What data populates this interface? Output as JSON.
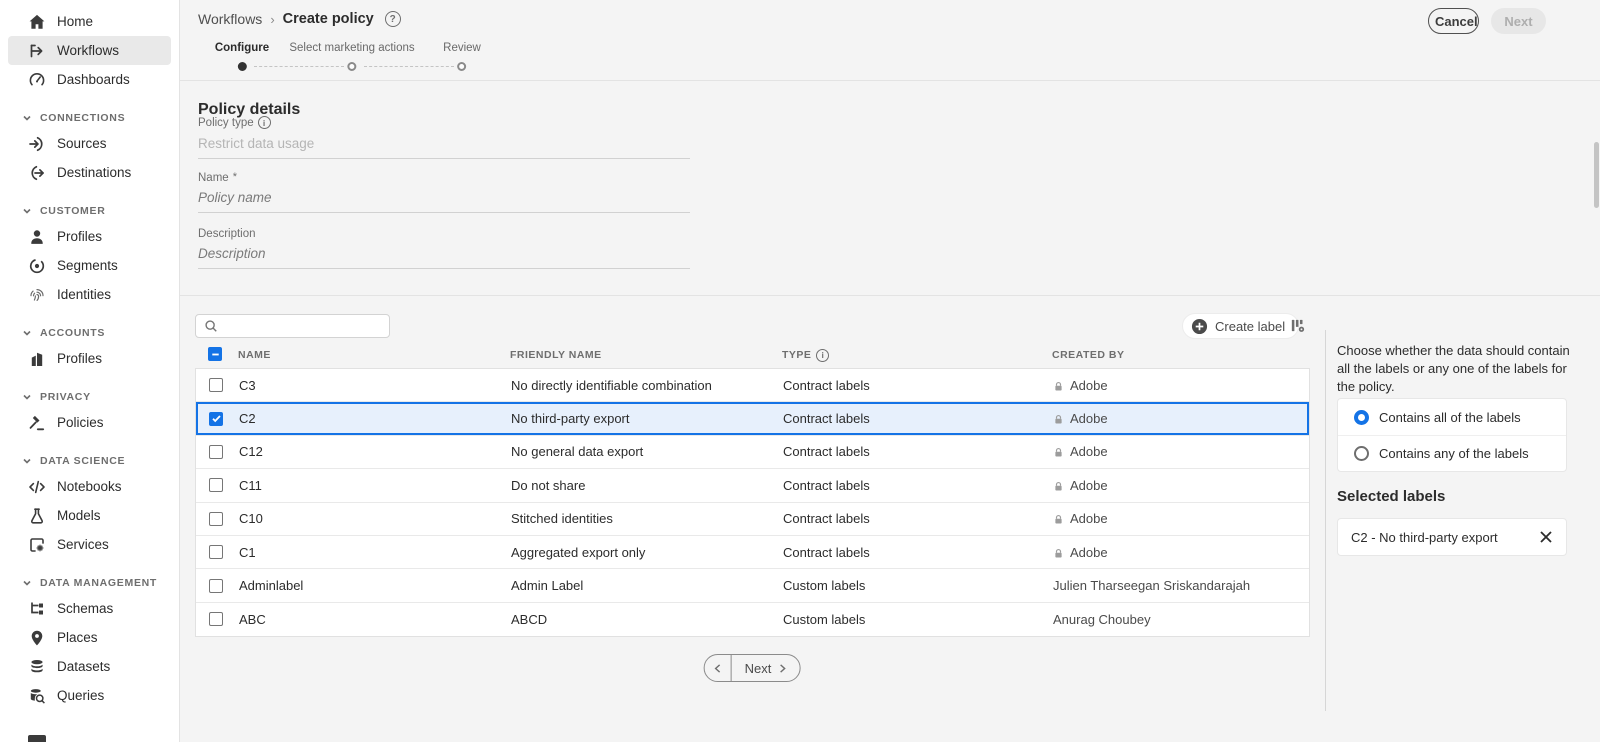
{
  "header": {
    "breadcrumb": [
      "Workflows",
      "Create policy"
    ],
    "separator": "›",
    "help_icon": "?",
    "cancel_label": "Cancel",
    "next_label": "Next"
  },
  "steps": [
    {
      "label": "Configure",
      "state": "current"
    },
    {
      "label": "Select marketing actions",
      "state": "upcoming"
    },
    {
      "label": "Review",
      "state": "upcoming"
    }
  ],
  "form": {
    "heading": "Policy details",
    "policy_type": {
      "label": "Policy type",
      "info_icon": "i",
      "value": "Restrict data usage",
      "disabled": true
    },
    "name": {
      "label": "Name",
      "required_marker": "*",
      "placeholder": "Policy name",
      "value": ""
    },
    "description": {
      "label": "Description",
      "placeholder": "Description",
      "value": ""
    }
  },
  "labels_table": {
    "search_placeholder": "",
    "create_label": "Create label",
    "columns": [
      "NAME",
      "FRIENDLY NAME",
      "TYPE",
      "CREATED BY"
    ],
    "type_info_icon": "i",
    "header_checkbox_state": "indeterminate",
    "rows": [
      {
        "name": "C3",
        "friendly_name": "No directly identifiable combination",
        "type": "Contract labels",
        "created_by": "Adobe",
        "locked": true,
        "checked": false
      },
      {
        "name": "C2",
        "friendly_name": "No third-party export",
        "type": "Contract labels",
        "created_by": "Adobe",
        "locked": true,
        "checked": true
      },
      {
        "name": "C12",
        "friendly_name": "No general data export",
        "type": "Contract labels",
        "created_by": "Adobe",
        "locked": true,
        "checked": false
      },
      {
        "name": "C11",
        "friendly_name": "Do not share",
        "type": "Contract labels",
        "created_by": "Adobe",
        "locked": true,
        "checked": false
      },
      {
        "name": "C10",
        "friendly_name": "Stitched identities",
        "type": "Contract labels",
        "created_by": "Adobe",
        "locked": true,
        "checked": false
      },
      {
        "name": "C1",
        "friendly_name": "Aggregated export only",
        "type": "Contract labels",
        "created_by": "Adobe",
        "locked": true,
        "checked": false
      },
      {
        "name": "Adminlabel",
        "friendly_name": "Admin Label",
        "type": "Custom labels",
        "created_by": "Julien Tharseegan Sriskandarajah",
        "locked": false,
        "checked": false
      },
      {
        "name": "ABC",
        "friendly_name": "ABCD",
        "type": "Custom labels",
        "created_by": "Anurag Choubey",
        "locked": false,
        "checked": false
      }
    ],
    "pagination": {
      "next_label": "Next"
    }
  },
  "right_panel": {
    "description": "Choose whether the data should contain all the labels or any one of the labels for the policy.",
    "options": [
      {
        "label": "Contains all of the labels",
        "selected": true
      },
      {
        "label": "Contains any of the labels",
        "selected": false
      }
    ],
    "selected_heading": "Selected labels",
    "selected_labels": [
      {
        "label": "C2 - No third-party export"
      }
    ]
  },
  "sidebar": {
    "groups": [
      {
        "items": [
          {
            "label": "Home",
            "icon": "home"
          },
          {
            "label": "Workflows",
            "icon": "workflows",
            "active": true
          },
          {
            "label": "Dashboards",
            "icon": "dashboards"
          }
        ]
      },
      {
        "header": "CONNECTIONS",
        "items": [
          {
            "label": "Sources",
            "icon": "sources"
          },
          {
            "label": "Destinations",
            "icon": "destinations"
          }
        ]
      },
      {
        "header": "CUSTOMER",
        "items": [
          {
            "label": "Profiles",
            "icon": "profile"
          },
          {
            "label": "Segments",
            "icon": "segments"
          },
          {
            "label": "Identities",
            "icon": "identities"
          }
        ]
      },
      {
        "header": "ACCOUNTS",
        "items": [
          {
            "label": "Profiles",
            "icon": "building"
          }
        ]
      },
      {
        "header": "PRIVACY",
        "items": [
          {
            "label": "Policies",
            "icon": "gavel"
          }
        ]
      },
      {
        "header": "DATA SCIENCE",
        "items": [
          {
            "label": "Notebooks",
            "icon": "code"
          },
          {
            "label": "Models",
            "icon": "flask"
          },
          {
            "label": "Services",
            "icon": "services"
          }
        ]
      },
      {
        "header": "DATA MANAGEMENT",
        "items": [
          {
            "label": "Schemas",
            "icon": "schemas"
          },
          {
            "label": "Places",
            "icon": "pin"
          },
          {
            "label": "Datasets",
            "icon": "datasets"
          },
          {
            "label": "Queries",
            "icon": "queries"
          }
        ]
      }
    ]
  },
  "colors": {
    "accent": "#1473e6",
    "selected_row_bg": "#e7f0fc",
    "selected_row_border": "#1473e6"
  }
}
